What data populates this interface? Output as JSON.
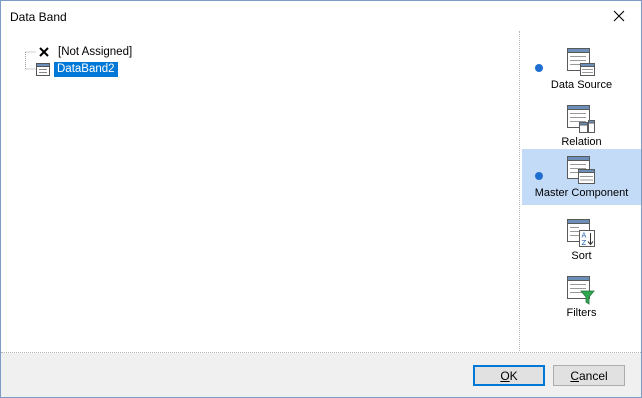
{
  "window": {
    "title": "Data Band"
  },
  "tree": {
    "items": [
      {
        "label": "[Not Assigned]",
        "icon": "x-mark-icon",
        "selected": false
      },
      {
        "label": "DataBand2",
        "icon": "databand-icon",
        "selected": true
      }
    ]
  },
  "sidebar": {
    "items": [
      {
        "label": "Data Source",
        "icon": "data-source-icon",
        "has_marker": true,
        "active": false
      },
      {
        "label": "Relation",
        "icon": "relation-icon",
        "has_marker": false,
        "active": false
      },
      {
        "label": "Master Component",
        "icon": "master-component-icon",
        "has_marker": true,
        "active": true
      },
      {
        "label": "Sort",
        "icon": "sort-icon",
        "has_marker": false,
        "active": false
      },
      {
        "label": "Filters",
        "icon": "filter-icon",
        "has_marker": false,
        "active": false
      }
    ]
  },
  "buttons": {
    "ok": {
      "first": "O",
      "rest": "K"
    },
    "cancel": {
      "first": "C",
      "rest": "ancel"
    }
  },
  "colors": {
    "selection": "#0078d7",
    "active_panel": "#c4dbf7",
    "marker": "#1e6fd0"
  }
}
